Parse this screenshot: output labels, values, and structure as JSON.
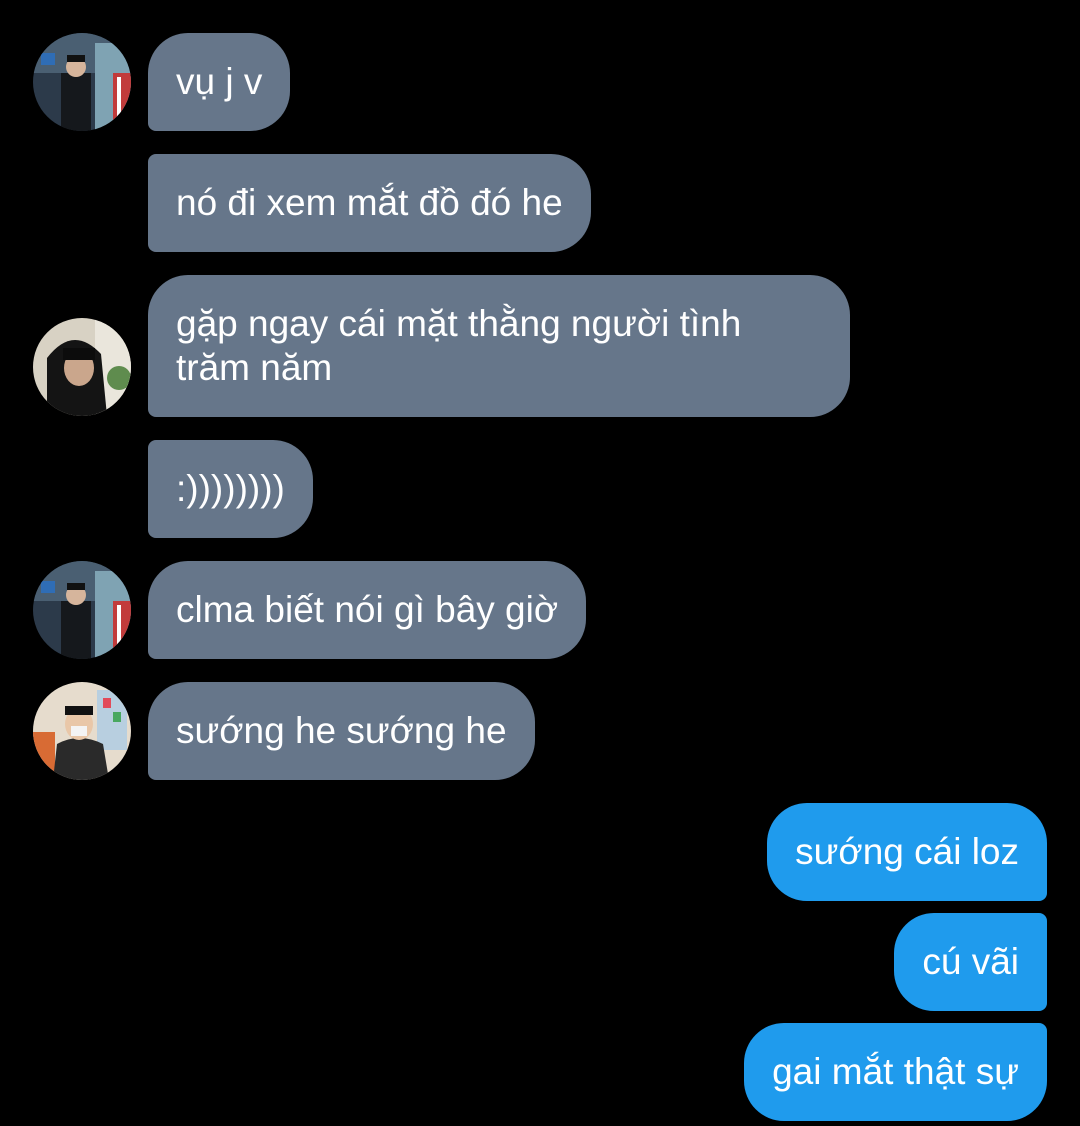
{
  "messages": [
    {
      "direction": "incoming",
      "text": "vụ j v"
    },
    {
      "direction": "incoming",
      "text": "nó đi xem mắt đồ đó he"
    },
    {
      "direction": "incoming",
      "text": "gặp ngay cái mặt thằng người tình trăm năm"
    },
    {
      "direction": "incoming",
      "text": ":))))))))"
    },
    {
      "direction": "incoming",
      "text": "clma biết nói gì bây giờ"
    },
    {
      "direction": "incoming",
      "text": "sướng he sướng he"
    },
    {
      "direction": "outgoing",
      "text": "sướng cái loz"
    },
    {
      "direction": "outgoing",
      "text": "cú vãi"
    },
    {
      "direction": "outgoing",
      "text": "gai mắt thật sự"
    }
  ],
  "colors": {
    "background": "#000000",
    "incoming_bubble": "#66768a",
    "outgoing_bubble": "#1f9bed",
    "text": "#ffffff"
  }
}
